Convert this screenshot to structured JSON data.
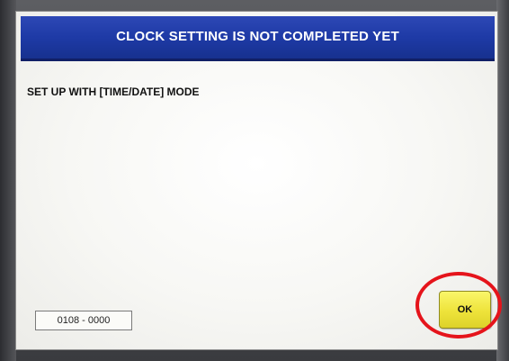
{
  "dialog": {
    "title": "CLOCK SETTING IS NOT COMPLETED YET",
    "message": "SET UP WITH [TIME/DATE] MODE",
    "error_code": "0108 - 0000",
    "ok_label": "OK"
  },
  "colors": {
    "title_bar": "#1e3aa6",
    "ok_button": "#f2ec4a",
    "highlight_ring": "#e5141b"
  }
}
